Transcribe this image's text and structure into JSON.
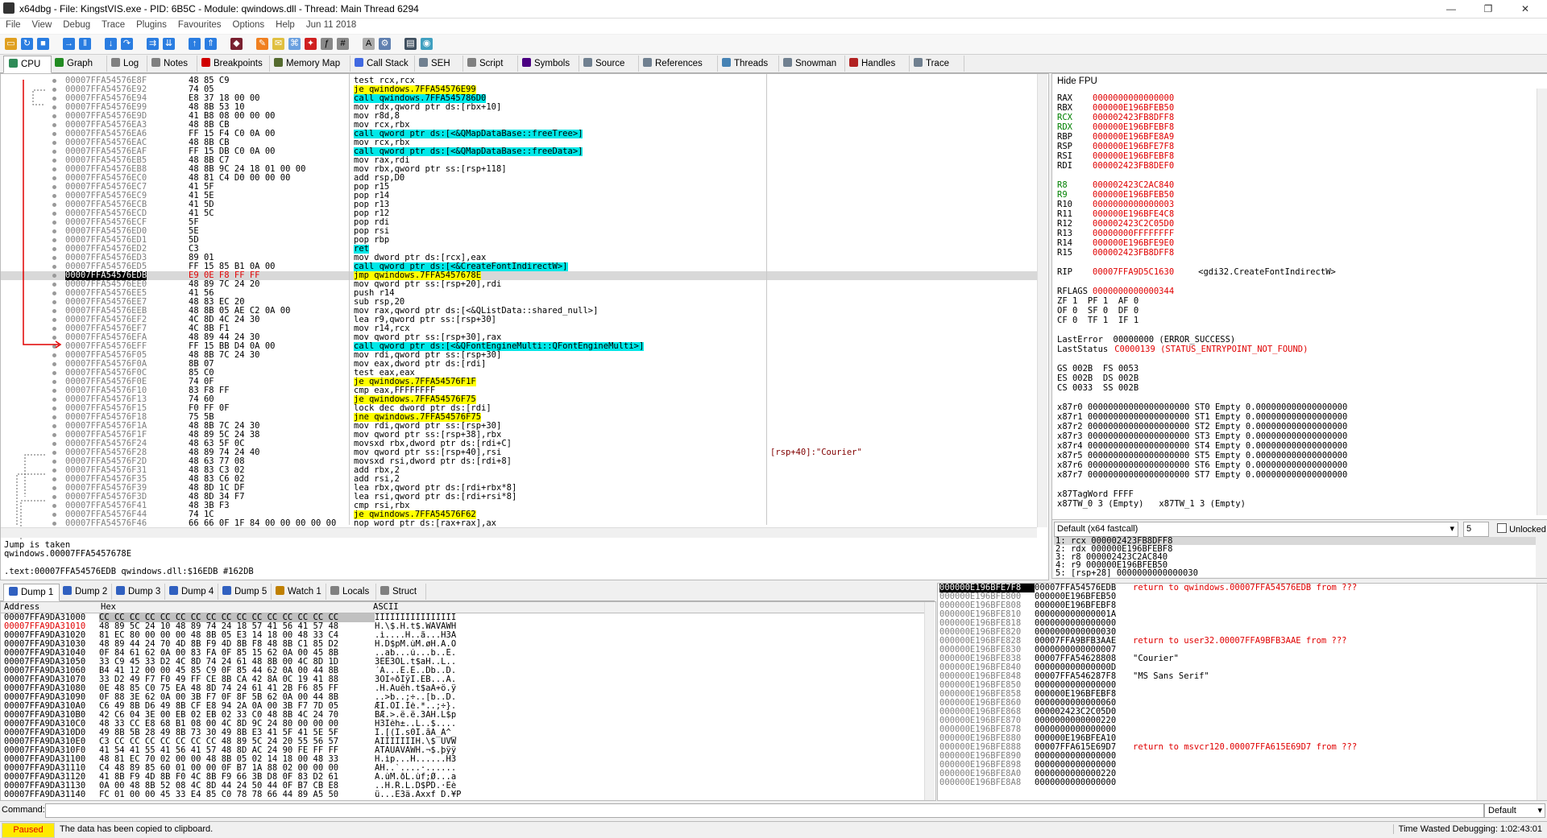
{
  "window": {
    "title": "x64dbg - File: KingstVIS.exe - PID: 6B5C - Module: qwindows.dll - Thread: Main Thread 6294",
    "controls": [
      "—",
      "❐",
      "✕"
    ]
  },
  "menu": [
    "File",
    "View",
    "Debug",
    "Trace",
    "Plugins",
    "Favourites",
    "Options",
    "Help",
    "Jun 11 2018"
  ],
  "tabs": [
    {
      "label": "CPU",
      "color": "#2e8b57"
    },
    {
      "label": "Graph",
      "color": "#228b22"
    },
    {
      "label": "Log",
      "color": "#808080"
    },
    {
      "label": "Notes",
      "color": "#808080"
    },
    {
      "label": "Breakpoints",
      "color": "#d00000"
    },
    {
      "label": "Memory Map",
      "color": "#556b2f"
    },
    {
      "label": "Call Stack",
      "color": "#4169e1"
    },
    {
      "label": "SEH",
      "color": "#708090"
    },
    {
      "label": "Script",
      "color": "#808080"
    },
    {
      "label": "Symbols",
      "color": "#4b0082"
    },
    {
      "label": "Source",
      "color": "#708090"
    },
    {
      "label": "References",
      "color": "#708090"
    },
    {
      "label": "Threads",
      "color": "#4682b4"
    },
    {
      "label": "Snowman",
      "color": "#708090"
    },
    {
      "label": "Handles",
      "color": "#b22222"
    },
    {
      "label": "Trace",
      "color": "#708090"
    }
  ],
  "disasm": [
    {
      "a": "00007FFA54576E8F",
      "b": "48 85 C9",
      "i": "test rcx,rcx",
      "k": "n"
    },
    {
      "a": "00007FFA54576E92",
      "b": "74 05",
      "i": "je qwindows.7FFA54576E99",
      "k": "j"
    },
    {
      "a": "00007FFA54576E94",
      "b": "E8 37 18 00 00",
      "i": "call qwindows.7FFA545786D0",
      "k": "c"
    },
    {
      "a": "00007FFA54576E99",
      "b": "48 8B 53 10",
      "i": "mov rdx,qword ptr ds:[rbx+10]",
      "k": "n"
    },
    {
      "a": "00007FFA54576E9D",
      "b": "41 B8 08 00 00 00",
      "i": "mov r8d,8",
      "k": "n"
    },
    {
      "a": "00007FFA54576EA3",
      "b": "48 8B CB",
      "i": "mov rcx,rbx",
      "k": "n"
    },
    {
      "a": "00007FFA54576EA6",
      "b": "FF 15 F4 C0 0A 00",
      "i": "call qword ptr ds:[<&QMapDataBase::freeTree>]",
      "k": "c"
    },
    {
      "a": "00007FFA54576EAC",
      "b": "48 8B CB",
      "i": "mov rcx,rbx",
      "k": "n"
    },
    {
      "a": "00007FFA54576EAF",
      "b": "FF 15 DB C0 0A 00",
      "i": "call qword ptr ds:[<&QMapDataBase::freeData>]",
      "k": "c"
    },
    {
      "a": "00007FFA54576EB5",
      "b": "48 8B C7",
      "i": "mov rax,rdi",
      "k": "n"
    },
    {
      "a": "00007FFA54576EB8",
      "b": "48 8B 9C 24 18 01 00 00",
      "i": "mov rbx,qword ptr ss:[rsp+118]",
      "k": "n"
    },
    {
      "a": "00007FFA54576EC0",
      "b": "48 81 C4 D0 00 00 00",
      "i": "add rsp,D0",
      "k": "n"
    },
    {
      "a": "00007FFA54576EC7",
      "b": "41 5F",
      "i": "pop r15",
      "k": "n"
    },
    {
      "a": "00007FFA54576EC9",
      "b": "41 5E",
      "i": "pop r14",
      "k": "n"
    },
    {
      "a": "00007FFA54576ECB",
      "b": "41 5D",
      "i": "pop r13",
      "k": "n"
    },
    {
      "a": "00007FFA54576ECD",
      "b": "41 5C",
      "i": "pop r12",
      "k": "n"
    },
    {
      "a": "00007FFA54576ECF",
      "b": "5F",
      "i": "pop rdi",
      "k": "n"
    },
    {
      "a": "00007FFA54576ED0",
      "b": "5E",
      "i": "pop rsi",
      "k": "n"
    },
    {
      "a": "00007FFA54576ED1",
      "b": "5D",
      "i": "pop rbp",
      "k": "n"
    },
    {
      "a": "00007FFA54576ED2",
      "b": "C3",
      "i": "ret",
      "k": "r"
    },
    {
      "a": "00007FFA54576ED3",
      "b": "89 01",
      "i": "mov dword ptr ds:[rcx],eax",
      "k": "n"
    },
    {
      "a": "00007FFA54576ED5",
      "b": "FF 15 85 B1 0A 00",
      "i": "call qword ptr ds:[<&CreateFontIndirectW>]",
      "k": "c"
    },
    {
      "a": "00007FFA54576EDB",
      "b": "E9 0E F8 FF FF",
      "i": "jmp qwindows.7FFA5457678E",
      "k": "j",
      "cur": true
    },
    {
      "a": "00007FFA54576EE0",
      "b": "48 89 7C 24 20",
      "i": "mov qword ptr ss:[rsp+20],rdi",
      "k": "n"
    },
    {
      "a": "00007FFA54576EE5",
      "b": "41 56",
      "i": "push r14",
      "k": "n"
    },
    {
      "a": "00007FFA54576EE7",
      "b": "48 83 EC 20",
      "i": "sub rsp,20",
      "k": "n"
    },
    {
      "a": "00007FFA54576EEB",
      "b": "48 8B 05 AE C2 0A 00",
      "i": "mov rax,qword ptr ds:[<&QListData::shared_null>]",
      "k": "n"
    },
    {
      "a": "00007FFA54576EF2",
      "b": "4C 8D 4C 24 30",
      "i": "lea r9,qword ptr ss:[rsp+30]",
      "k": "n"
    },
    {
      "a": "00007FFA54576EF7",
      "b": "4C 8B F1",
      "i": "mov r14,rcx",
      "k": "n"
    },
    {
      "a": "00007FFA54576EFA",
      "b": "48 89 44 24 30",
      "i": "mov qword ptr ss:[rsp+30],rax",
      "k": "n"
    },
    {
      "a": "00007FFA54576EFF",
      "b": "FF 15 BB D4 0A 00",
      "i": "call qword ptr ds:[<&QFontEngineMulti::QFontEngineMulti>]",
      "k": "c"
    },
    {
      "a": "00007FFA54576F05",
      "b": "48 8B 7C 24 30",
      "i": "mov rdi,qword ptr ss:[rsp+30]",
      "k": "n"
    },
    {
      "a": "00007FFA54576F0A",
      "b": "8B 07",
      "i": "mov eax,dword ptr ds:[rdi]",
      "k": "n"
    },
    {
      "a": "00007FFA54576F0C",
      "b": "85 C0",
      "i": "test eax,eax",
      "k": "n"
    },
    {
      "a": "00007FFA54576F0E",
      "b": "74 0F",
      "i": "je qwindows.7FFA54576F1F",
      "k": "j"
    },
    {
      "a": "00007FFA54576F10",
      "b": "83 F8 FF",
      "i": "cmp eax,FFFFFFFF",
      "k": "n"
    },
    {
      "a": "00007FFA54576F13",
      "b": "74 60",
      "i": "je qwindows.7FFA54576F75",
      "k": "j"
    },
    {
      "a": "00007FFA54576F15",
      "b": "F0 FF 0F",
      "i": "lock dec dword ptr ds:[rdi]",
      "k": "n"
    },
    {
      "a": "00007FFA54576F18",
      "b": "75 5B",
      "i": "jne qwindows.7FFA54576F75",
      "k": "j"
    },
    {
      "a": "00007FFA54576F1A",
      "b": "48 8B 7C 24 30",
      "i": "mov rdi,qword ptr ss:[rsp+30]",
      "k": "n"
    },
    {
      "a": "00007FFA54576F1F",
      "b": "48 89 5C 24 38",
      "i": "mov qword ptr ss:[rsp+38],rbx",
      "k": "n"
    },
    {
      "a": "00007FFA54576F24",
      "b": "48 63 5F 0C",
      "i": "movsxd rbx,dword ptr ds:[rdi+C]",
      "k": "n"
    },
    {
      "a": "00007FFA54576F28",
      "b": "48 89 74 24 40",
      "i": "mov qword ptr ss:[rsp+40],rsi",
      "k": "n",
      "cm": "[rsp+40]:\"Courier\""
    },
    {
      "a": "00007FFA54576F2D",
      "b": "48 63 77 08",
      "i": "movsxd rsi,dword ptr ds:[rdi+8]",
      "k": "n"
    },
    {
      "a": "00007FFA54576F31",
      "b": "48 83 C3 02",
      "i": "add rbx,2",
      "k": "n"
    },
    {
      "a": "00007FFA54576F35",
      "b": "48 83 C6 02",
      "i": "add rsi,2",
      "k": "n"
    },
    {
      "a": "00007FFA54576F39",
      "b": "48 8D 1C DF",
      "i": "lea rbx,qword ptr ds:[rdi+rbx*8]",
      "k": "n"
    },
    {
      "a": "00007FFA54576F3D",
      "b": "48 8D 34 F7",
      "i": "lea rsi,qword ptr ds:[rdi+rsi*8]",
      "k": "n"
    },
    {
      "a": "00007FFA54576F41",
      "b": "48 3B F3",
      "i": "cmp rsi,rbx",
      "k": "n"
    },
    {
      "a": "00007FFA54576F44",
      "b": "74 1C",
      "i": "je qwindows.7FFA54576F62",
      "k": "j"
    },
    {
      "a": "00007FFA54576F46",
      "b": "66 66 0F 1F 84 00 00 00 00 00",
      "i": "nop word ptr ds:[rax+rax],ax",
      "k": "n"
    }
  ],
  "info": {
    "line1": "Jump is taken",
    "line2": "qwindows.00007FFA5457678E",
    "line3": ".text:00007FFA54576EDB qwindows.dll:$16EDB #162DB"
  },
  "registers": {
    "header": "Hide FPU",
    "gp": [
      [
        "RAX",
        "0000000000000000",
        false
      ],
      [
        "RBX",
        "000000E196BFEB50",
        false
      ],
      [
        "RCX",
        "000002423FB8DFF8",
        true
      ],
      [
        "RDX",
        "000000E196BFEBF8",
        true
      ],
      [
        "RBP",
        "000000E196BFE8A9",
        false
      ],
      [
        "RSP",
        "000000E196BFE7F8",
        false
      ],
      [
        "RSI",
        "000000E196BFEBF8",
        false
      ],
      [
        "RDI",
        "000002423FB8DEF0",
        false
      ]
    ],
    "ext": [
      [
        "R8",
        "000002423C2AC840",
        true
      ],
      [
        "R9",
        "000000E196BFEB50",
        true
      ],
      [
        "R10",
        "0000000000000003",
        false
      ],
      [
        "R11",
        "000000E196BFE4C8",
        false
      ],
      [
        "R12",
        "000002423C2C05D0",
        false
      ],
      [
        "R13",
        "00000000FFFFFFFF",
        false
      ],
      [
        "R14",
        "000000E196BFE9E0",
        false
      ],
      [
        "R15",
        "000002423FB8DFF8",
        false
      ]
    ],
    "rip_name": "RIP",
    "rip": "00007FFA9D5C1630",
    "rip_sym": "<gdi32.CreateFontIndirectW>",
    "rflags_name": "RFLAGS",
    "rflags": "0000000000000344",
    "flags": [
      "ZF 1  PF 1  AF 0",
      "OF 0  SF 0  DF 0",
      "CF 0  TF 1  IF 1"
    ],
    "lasterror": "LastError  00000000 (ERROR_SUCCESS)",
    "laststatus_label": "LastStatus",
    "laststatus": "C0000139 (STATUS_ENTRYPOINT_NOT_FOUND)",
    "segs": [
      "GS 002B  FS 0053",
      "ES 002B  DS 002B",
      "CS 0033  SS 002B"
    ],
    "fpu": [
      "x87r0 00000000000000000000 ST0 Empty 0.000000000000000000",
      "x87r1 00000000000000000000 ST1 Empty 0.000000000000000000",
      "x87r2 00000000000000000000 ST2 Empty 0.000000000000000000",
      "x87r3 00000000000000000000 ST3 Empty 0.000000000000000000",
      "x87r4 00000000000000000000 ST4 Empty 0.000000000000000000",
      "x87r5 00000000000000000000 ST5 Empty 0.000000000000000000",
      "x87r6 00000000000000000000 ST6 Empty 0.000000000000000000",
      "x87r7 00000000000000000000 ST7 Empty 0.000000000000000000"
    ],
    "tagword": "x87TagWord FFFF",
    "tw": "x87TW_0 3 (Empty)   x87TW_1 3 (Empty)"
  },
  "callconv": {
    "select": "Default (x64 fastcall)",
    "count": "5",
    "unlocked": "Unlocked",
    "args": [
      "1: rcx 000002423FB8DFF8",
      "2: rdx 000000E196BFEBF8",
      "3: r8 000002423C2AC840",
      "4: r9 000000E196BFEB50",
      "5: [rsp+28] 0000000000000030"
    ]
  },
  "dumptabs": [
    "Dump 1",
    "Dump 2",
    "Dump 3",
    "Dump 4",
    "Dump 5",
    "Watch 1",
    "Locals",
    "Struct"
  ],
  "dump": {
    "headers": [
      "Address",
      "Hex",
      "ASCII"
    ],
    "rows": [
      [
        "00007FFA9DA31000",
        "CC CC CC CC CC CC CC CC CC CC CC CC CC CC CC CC",
        "ÌÌÌÌÌÌÌÌÌÌÌÌÌÌÌÌ"
      ],
      [
        "00007FFA9DA31010",
        "48 89 5C 24 10 48 89 74 24 18 57 41 56 41 57 48",
        "H.\\$.H.t$.WAVAWH"
      ],
      [
        "00007FFA9DA31020",
        "81 EC 80 00 00 00 48 8B 05 E3 14 18 00 48 33 C4",
        ".ì....H..ã...H3Ä"
      ],
      [
        "00007FFA9DA31030",
        "48 89 44 24 70 4D 8B F9 4D 8B F8 48 8B C1 85 D2",
        "H.D$pM.ùM.øH.Á.Ò"
      ],
      [
        "00007FFA9DA31040",
        "0F 84 61 62 0A 00 83 FA 0F 85 15 62 0A 00 45 8B",
        "..ab...ú...b..E."
      ],
      [
        "00007FFA9DA31050",
        "33 C9 45 33 D2 4C 8D 74 24 61 48 8B 00 4C 8D 1D",
        "3ÉE3ÒL.t$aH..L.."
      ],
      [
        "00007FFA9DA31060",
        "B4 41 12 00 00 45 85 C9 0F 85 44 62 0A 00 44 8B",
        "´A...E.É..Db..D."
      ],
      [
        "00007FFA9DA31070",
        "33 D2 49 F7 F0 49 FF CE 8B CA 42 8A 0C 19 41 88",
        "3ÒI÷ðIÿÎ.ÊB...A."
      ],
      [
        "00007FFA9DA31080",
        "0E 48 85 C0 75 EA 48 8D 74 24 61 41 2B F6 85 FF",
        ".H.Àuêh.t$aA+ö.ÿ"
      ],
      [
        "00007FFA9DA31090",
        "0F 88 3E 62 0A 00 3B F7 0F 8F 5B 62 0A 00 44 8B",
        "..>b..;÷..[b..D."
      ],
      [
        "00007FFA9DA310A0",
        "C6 49 8B D6 49 8B CF E8 94 2A 0A 00 3B F7 7D 05",
        "ÆI.ÖI.Ïè.*..;÷}."
      ],
      [
        "00007FFA9DA310B0",
        "42 C6 04 3E 00 EB 02 EB 02 33 C0 48 8B 4C 24 70",
        "BÆ.>.ë.ë.3ÀH.L$p"
      ],
      [
        "00007FFA9DA310C0",
        "48 33 CC E8 68 B1 08 00 4C 8D 9C 24 80 00 00 00",
        "H3Ìèh±..L..$...."
      ],
      [
        "00007FFA9DA310D0",
        "49 8B 5B 28 49 8B 73 30 49 8B E3 41 5F 41 5E 5F",
        "I.[(I.s0I.ãA_A^_"
      ],
      [
        "00007FFA9DA310E0",
        "C3 CC CC CC CC CC CC CC 48 89 5C 24 20 55 56 57",
        "ÃÌÌÌÌÌÌÌH.\\$ UVW"
      ],
      [
        "00007FFA9DA310F0",
        "41 54 41 55 41 56 41 57 48 8D AC 24 90 FE FF FF",
        "ATAUAVAWH.¬$.þÿÿ"
      ],
      [
        "00007FFA9DA31100",
        "48 81 EC 70 02 00 00 48 8B 05 02 14 18 00 48 33",
        "H.ìp...H......H3"
      ],
      [
        "00007FFA9DA31110",
        "C4 48 89 85 60 01 00 00 0F B7 1A 88 02 00 00 00",
        "ÄH..`....·......"
      ],
      [
        "00007FFA9DA31120",
        "41 8B F9 4D 8B F0 4C 8B F9 66 3B D8 0F 83 D2 61",
        "A.ùM.ðL.ùf;Ø...a"
      ],
      [
        "00007FFA9DA31130",
        "0A 00 48 8B 52 08 4C 8D 44 24 50 44 0F B7 CB E8",
        "..H.R.L.D$PD.·Ëè"
      ],
      [
        "00007FFA9DA31140",
        "FC 01 00 00 45 33 E4 85 C0 78 78 66 44 89 A5 50",
        "ü...E3ä.Àxxf D.¥P"
      ]
    ]
  },
  "stack": [
    [
      "000000E196BFE7F8",
      "00007FFA54576EDB",
      "return to qwindows.00007FFA54576EDB from ???",
      true
    ],
    [
      "000000E196BFE800",
      "000000E196BFEB50",
      "",
      false
    ],
    [
      "000000E196BFE808",
      "000000E196BFEBF8",
      "",
      false
    ],
    [
      "000000E196BFE810",
      "000000000000001A",
      "",
      false
    ],
    [
      "000000E196BFE818",
      "0000000000000000",
      "",
      false
    ],
    [
      "000000E196BFE820",
      "0000000000000030",
      "",
      false
    ],
    [
      "000000E196BFE828",
      "00007FFA9BFB3AAE",
      "return to user32.00007FFA9BFB3AAE from ???",
      false
    ],
    [
      "000000E196BFE830",
      "0000000000000007",
      "",
      false
    ],
    [
      "000000E196BFE838",
      "00007FFA54628808",
      "\"Courier\"",
      false
    ],
    [
      "000000E196BFE840",
      "000000000000000D",
      "",
      false
    ],
    [
      "000000E196BFE848",
      "00007FFA546287F8",
      "\"MS Sans Serif\"",
      false
    ],
    [
      "000000E196BFE850",
      "0000000000000000",
      "",
      false
    ],
    [
      "000000E196BFE858",
      "000000E196BFEBF8",
      "",
      false
    ],
    [
      "000000E196BFE860",
      "0000000000000060",
      "",
      false
    ],
    [
      "000000E196BFE868",
      "000002423C2C05D0",
      "",
      false
    ],
    [
      "000000E196BFE870",
      "0000000000000220",
      "",
      false
    ],
    [
      "000000E196BFE878",
      "0000000000000000",
      "",
      false
    ],
    [
      "000000E196BFE880",
      "000000E196BFEA10",
      "",
      false
    ],
    [
      "000000E196BFE888",
      "00007FFA615E69D7",
      "return to msvcr120.00007FFA615E69D7 from ???",
      false
    ],
    [
      "000000E196BFE890",
      "0000000000000000",
      "",
      false
    ],
    [
      "000000E196BFE898",
      "0000000000000000",
      "",
      false
    ],
    [
      "000000E196BFE8A0",
      "0000000000000220",
      "",
      false
    ],
    [
      "000000E196BFE8A8",
      "0000000000000000",
      "",
      false
    ]
  ],
  "command": {
    "label": "Command:",
    "value": "",
    "mode": "Default"
  },
  "status": {
    "state": "Paused",
    "message": "The data has been copied to clipboard.",
    "time": "Time Wasted Debugging: 1:02:43:01"
  }
}
